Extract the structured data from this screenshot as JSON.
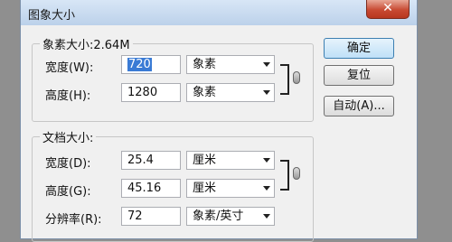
{
  "window": {
    "title": "图象大小",
    "close_glyph": "✕"
  },
  "pixel_dimensions": {
    "legend": "象素大小:2.64M",
    "width": {
      "label": "宽度(W):",
      "value": "720",
      "unit": "象素"
    },
    "height": {
      "label": "高度(H):",
      "value": "1280",
      "unit": "象素"
    }
  },
  "document_size": {
    "legend": "文档大小:",
    "width": {
      "label": "宽度(D):",
      "value": "25.4",
      "unit": "厘米"
    },
    "height": {
      "label": "高度(G):",
      "value": "45.16",
      "unit": "厘米"
    },
    "resolution": {
      "label": "分辨率(R):",
      "value": "72",
      "unit": "象素/英寸"
    }
  },
  "buttons": {
    "ok": "确定",
    "reset": "复位",
    "auto": "自动(A)..."
  },
  "icons": {
    "close": "close-icon",
    "link": "chain-link-icon",
    "dropdown": "chevron-down-icon"
  }
}
